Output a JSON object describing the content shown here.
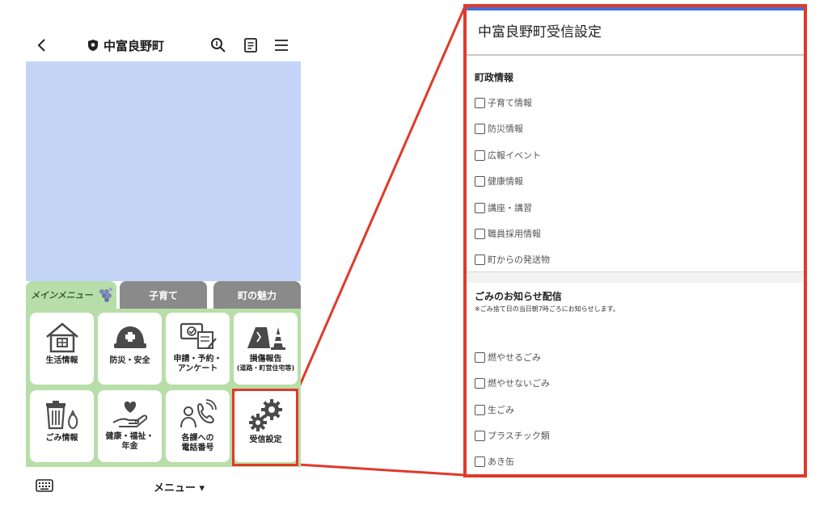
{
  "header": {
    "title": "中富良野町",
    "icons": [
      "back-icon",
      "shield-icon",
      "search-icon",
      "document-icon",
      "menu-icon"
    ]
  },
  "tabs": [
    {
      "label": "メインメニュー",
      "active": true
    },
    {
      "label": "子育て",
      "active": false
    },
    {
      "label": "町の魅力",
      "active": false
    }
  ],
  "menu_items": [
    {
      "label": "生活情報",
      "icon": "house-icon"
    },
    {
      "label": "防災・安全",
      "icon": "helmet-icon"
    },
    {
      "label": "申請・予約・\nアンケート",
      "icon": "form-icon"
    },
    {
      "label": "損傷報告",
      "sub": "(道路・町営住宅等)",
      "icon": "road-damage-icon"
    },
    {
      "label": "ごみ情報",
      "icon": "trash-icon"
    },
    {
      "label": "健康・福祉・\n年金",
      "icon": "heart-hand-icon"
    },
    {
      "label": "各課への\n電話番号",
      "icon": "phone-person-icon"
    },
    {
      "label": "受信設定",
      "icon": "gears-icon"
    }
  ],
  "bottom": {
    "menu_label": "メニュー ▾"
  },
  "colors": {
    "highlight": "#e03a2a",
    "menu_bg": "#b7dea8",
    "banner": "#c3d4f7",
    "icon": "#4a4a4a"
  },
  "settings": {
    "title": "中富良野町受信設定",
    "section1": {
      "title": "町政情報",
      "options": [
        "子育て情報",
        "防災情報",
        "広報イベント",
        "健康情報",
        "講座・講習",
        "職員採用情報",
        "町からの発送物"
      ]
    },
    "section2": {
      "title": "ごみのお知らせ配信",
      "note": "※ごみ捨て日の当日朝7時ごろにお知らせします。",
      "options": [
        "燃やせるごみ",
        "燃やせないごみ",
        "生ごみ",
        "プラスチック類",
        "あき缶"
      ]
    }
  }
}
